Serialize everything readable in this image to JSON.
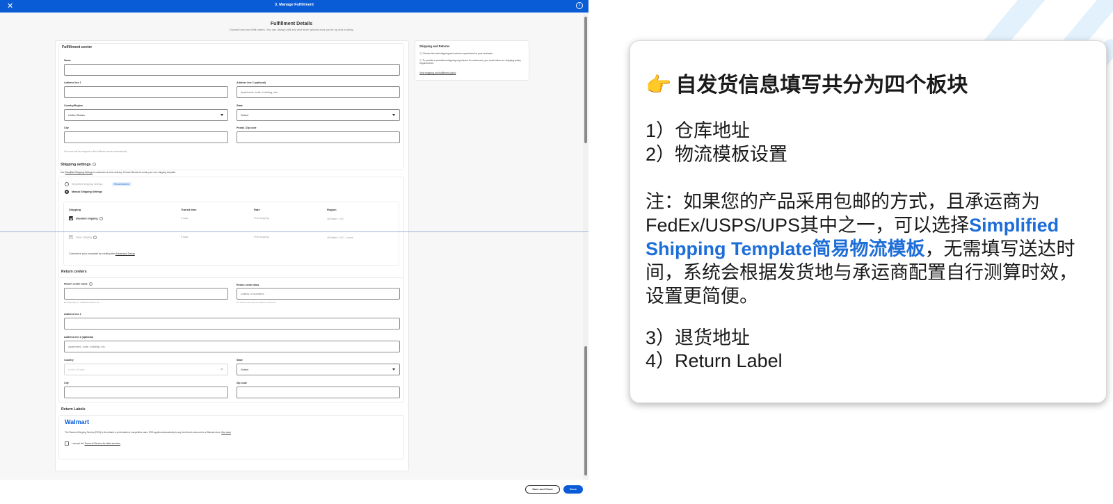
{
  "window": {
    "close_icon": "close-icon",
    "title": "3. Manage Fulfillment",
    "info_icon": "info-icon"
  },
  "page": {
    "heading": "Fulfillment Details",
    "subheading": "Choose how you fulfill orders. You can always edit and add more options once you're up and running."
  },
  "fulfillment_center": {
    "title": "Fulfillment center",
    "name_label": "Name",
    "address1_label": "Address line 1",
    "address2_label": "Address line 2 (optional)",
    "address2_placeholder": "Apartment, suite, building, etc.",
    "country_label": "Country/Region",
    "country_value": "United States",
    "state_label": "State",
    "state_value": "Select",
    "city_label": "City",
    "zip_label": "Postal / Zip code",
    "note": "All events will be assigned to this fulfillment center automatically."
  },
  "sidebar": {
    "title": "Shipping and Returns",
    "item1": "Choose the best shipping and returns experience for your business.",
    "item2": "To provide a consistent shipping experience for customers, you must follow our shipping policy requirements.",
    "link": "View shipping and fulfillment policy"
  },
  "shipping_settings": {
    "title": "Shipping settings",
    "desc_prefix": "Use",
    "desc_link": "Simplified Shipping Settings",
    "desc_suffix": "to customize on-time delivery. Choose Manual to create your own shipping template.",
    "option_simplified": "Simplified Shipping Settings",
    "recommended_badge": "Recommended",
    "option_manual": "Manual Shipping Settings",
    "columns": [
      "Shipping",
      "Transit time",
      "Rate",
      "Region"
    ],
    "rows": [
      {
        "shipping": "Standard shipping",
        "transit": "5 days",
        "rate": "Free shipping",
        "region": "48 States + DC"
      },
      {
        "shipping": "Value shipping",
        "transit": "6 days",
        "rate": "Free shipping",
        "region": "48 States + DC, 1 more"
      }
    ],
    "customize_prefix": "Customize your template by visiting the",
    "customize_link": "Advanced Setup"
  },
  "return_centers": {
    "title": "Return centers",
    "name_label": "Return center name",
    "name_hint": "Example: Bay Tel, Fulfillment Returns Inc.",
    "alias_label": "Return center alias",
    "alias_placeholder": "Letters or numbers",
    "alias_hint": "For internal use only. Not visible to customers.",
    "address1_label": "Address line 1",
    "address2_label": "Address line 2 (optional)",
    "address2_placeholder": "Apartment, suite, building, etc.",
    "country_label": "Country",
    "country_value": "United States",
    "state_label": "State",
    "state_value": "Select",
    "city_label": "City",
    "zip_label": "Zip code"
  },
  "return_labels": {
    "title": "Return Labels",
    "brand": "Walmart",
    "desc": "The Returns Shipping Service (RSS) is the default to print labels at competitive rates. RSS applies automatically to any item that is returned to a Walmart store.",
    "desc_link": "See more",
    "accept_prefix": "I accept the",
    "accept_link": "Terms of Service for label services"
  },
  "footer": {
    "save_close": "Save and Close",
    "done": "Done"
  },
  "callout": {
    "hand_icon": "pointing-hand-icon",
    "title": "自发货信息填写共分为四个板块",
    "item1": "1）仓库地址",
    "item2": "2）物流模板设置",
    "note_part1": "注：如果您的产品采用包邮的方式，且承运商为FedEx/USPS/UPS其中之一，可以选择",
    "note_highlight": "Simplified Shipping Template简易物流模板",
    "note_part2": "，无需填写送达时间，系统会根据发货地与承运商配置自行测算时效，设置更简便。",
    "item3": "3）退货地址",
    "item4": "4）Return Label"
  },
  "colors": {
    "brand_blue": "#0a5bd6",
    "highlight_blue": "#1d6ed8"
  }
}
